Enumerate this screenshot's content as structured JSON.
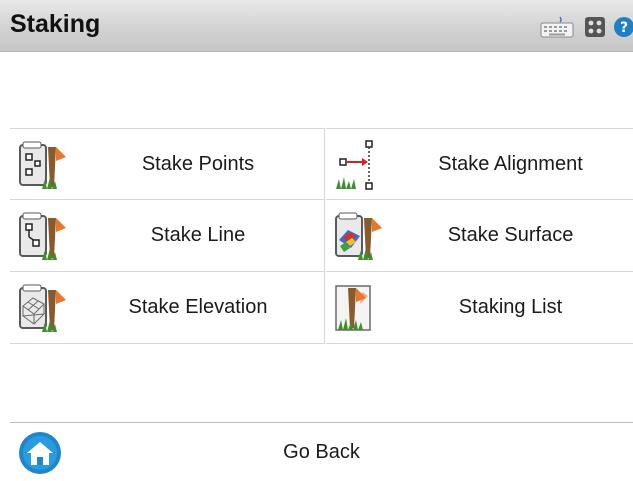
{
  "window": {
    "title": "Staking",
    "toolbar_icons": [
      "keyboard-icon",
      "apps-icon",
      "help-icon"
    ]
  },
  "menu": {
    "items": [
      {
        "label": "Stake Points",
        "icon": "stake-points-icon"
      },
      {
        "label": "Stake Alignment",
        "icon": "stake-alignment-icon"
      },
      {
        "label": "Stake Line",
        "icon": "stake-line-icon"
      },
      {
        "label": "Stake Surface",
        "icon": "stake-surface-icon"
      },
      {
        "label": "Stake Elevation",
        "icon": "stake-elevation-icon"
      },
      {
        "label": "Staking List",
        "icon": "staking-list-icon"
      }
    ]
  },
  "footer": {
    "go_back_label": "Go Back",
    "icon": "home-icon"
  },
  "colors": {
    "titlebar_top": "#e9e9e9",
    "titlebar_bottom": "#c6c6c6",
    "home_blue": "#1f86c8",
    "stake_orange": "#e8772e",
    "grass_green": "#3f8f2f"
  }
}
